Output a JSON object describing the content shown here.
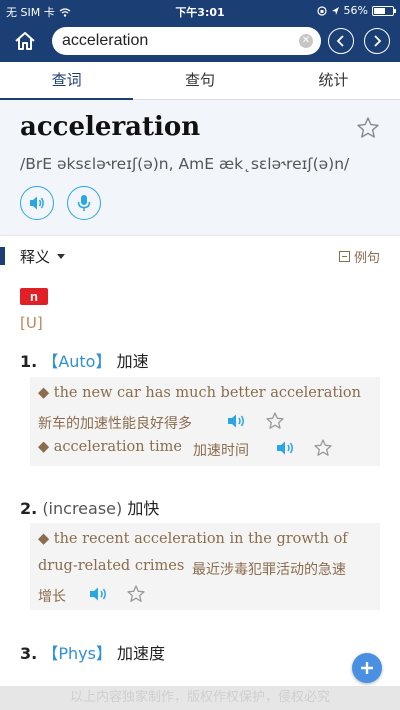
{
  "status_bar": {
    "carrier": "无 SIM 卡",
    "time": "下午3:01",
    "battery_percent": "56%",
    "battery_level": 0.56
  },
  "nav": {
    "search_value": "acceleration",
    "icons": [
      "home-icon",
      "clear-icon",
      "back-icon",
      "forward-icon"
    ]
  },
  "tabs": [
    {
      "label": "查词",
      "active": true
    },
    {
      "label": "查句",
      "active": false
    },
    {
      "label": "统计",
      "active": false
    }
  ],
  "entry": {
    "headword": "acceleration",
    "phonetic": "/BrE əksɛlə˞reɪʃ(ə)n, AmE æk˛sɛlə˞reɪʃ(ə)n/"
  },
  "section": {
    "title": "释义",
    "example_toggle": "例句"
  },
  "pos": "n",
  "grammar": "[U]",
  "senses": [
    {
      "num": "1.",
      "tag": "【Auto】",
      "definition": "加速",
      "examples": [
        {
          "en": "◆ the new car has much better acceleration",
          "zh": "新车的加速性能良好得多"
        },
        {
          "en": "◆ acceleration time",
          "zh": "加速时间"
        }
      ]
    },
    {
      "num": "2.",
      "tag": "(increase)",
      "definition": "加快",
      "examples": [
        {
          "en": "◆ the recent acceleration in the growth of",
          "en2": "drug-related crimes",
          "zh": "最近涉毒犯罪活动的急速",
          "zh2": "增长"
        }
      ]
    },
    {
      "num": "3.",
      "tag": "【Phys】",
      "definition": "加速度"
    }
  ],
  "footer": "以上内容独家制作，版权作权保护，侵权必究",
  "colors": {
    "nav_bg": "#1b3f74",
    "accent": "#2aa7e0",
    "pos_badge": "#e11f27",
    "example_text": "#8a6d4d"
  }
}
